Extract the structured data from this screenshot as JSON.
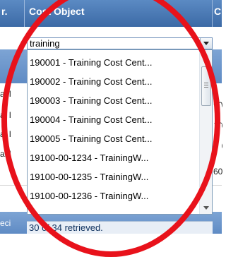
{
  "header": {
    "left_fragment": "r.",
    "cost_object_label": "Cost Object",
    "right_fragment": "C"
  },
  "combo": {
    "value": "training"
  },
  "dropdown": {
    "items": [
      "190001 - Training Cost Cent...",
      "190002 - Training Cost Cent...",
      "190003 - Training Cost Cent...",
      "190004 - Training Cost Cent...",
      "190005 - Training Cost Cent...",
      "19100-00-1234 - TrainingW...",
      "19100-00-1235 - TrainingW...",
      "19100-00-1236 - TrainingW..."
    ],
    "status": "30 of 34 retrieved."
  },
  "background_grid": {
    "left_fragments": [
      "al I",
      "al I",
      "al I",
      "al I",
      "eci"
    ],
    "right_fragments": [
      "60",
      "60",
      "60",
      "60"
    ]
  },
  "colors": {
    "header": "#4a78b5",
    "highlight_ring": "#e8121b",
    "status_bg": "#e8eef6"
  }
}
